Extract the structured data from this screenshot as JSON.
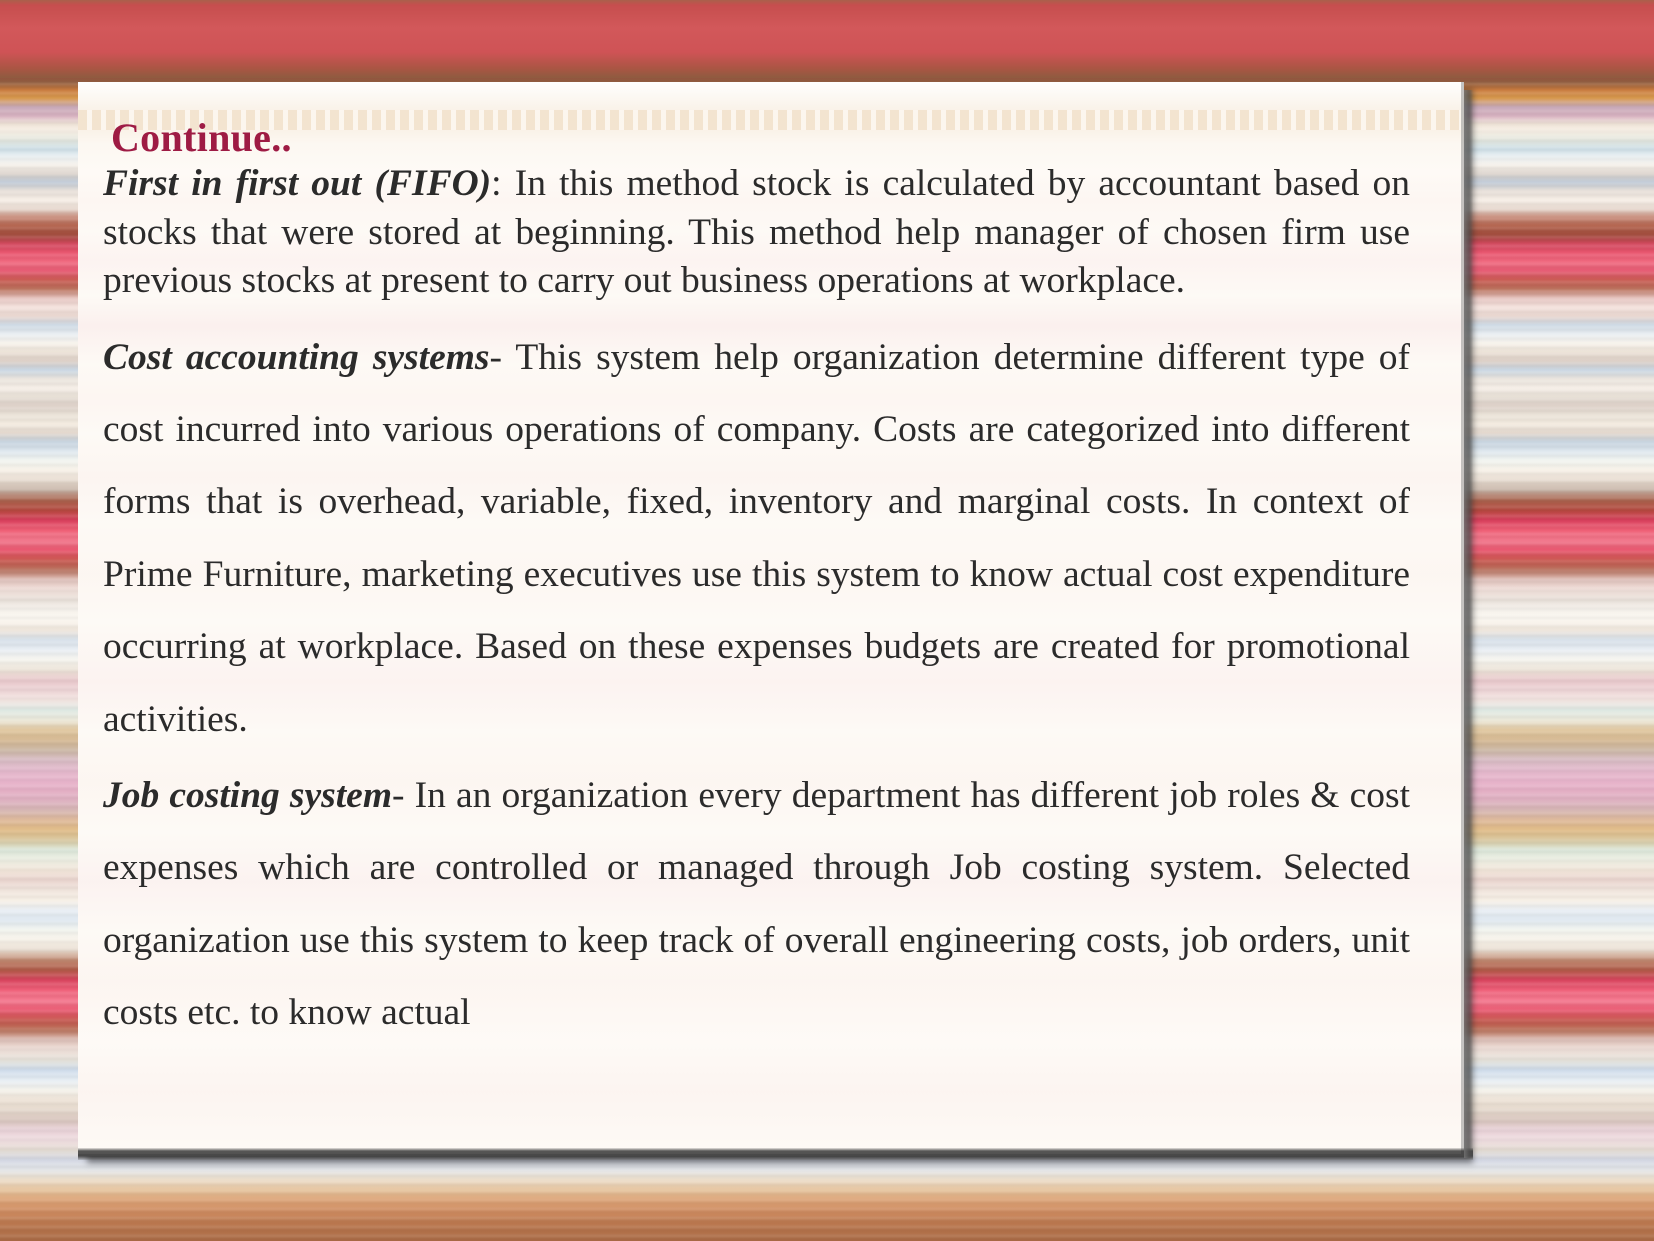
{
  "slide": {
    "title": "Continue..",
    "title_color": "#9E1B44",
    "body_text_color": "#2B2B2B",
    "card_background": "#FDF9F4",
    "top_band_color": "#CF5356"
  },
  "paragraphs": {
    "fifo": {
      "lead": "First in first out (FIFO)",
      "body": ":  In this method stock is calculated by accountant based on stocks that were stored at beginning. This method help manager of chosen firm use previous stocks at present to carry out business operations at workplace."
    },
    "cost_accounting": {
      "lead": "Cost accounting systems",
      "body": "- This system help organization determine different type of cost incurred into various operations of company. Costs are categorized into different forms that is overhead, variable, fixed, inventory and marginal costs. In context of Prime Furniture, marketing executives use this system to know actual cost expenditure occurring at workplace. Based on these expenses budgets are created for promotional activities."
    },
    "job_costing": {
      "lead": "Job costing system",
      "body": "-  In an organization every department has different job roles & cost expenses which are controlled or managed through Job costing system. Selected organization use this system to keep track of overall engineering costs, job orders, unit costs etc. to know actual"
    }
  }
}
